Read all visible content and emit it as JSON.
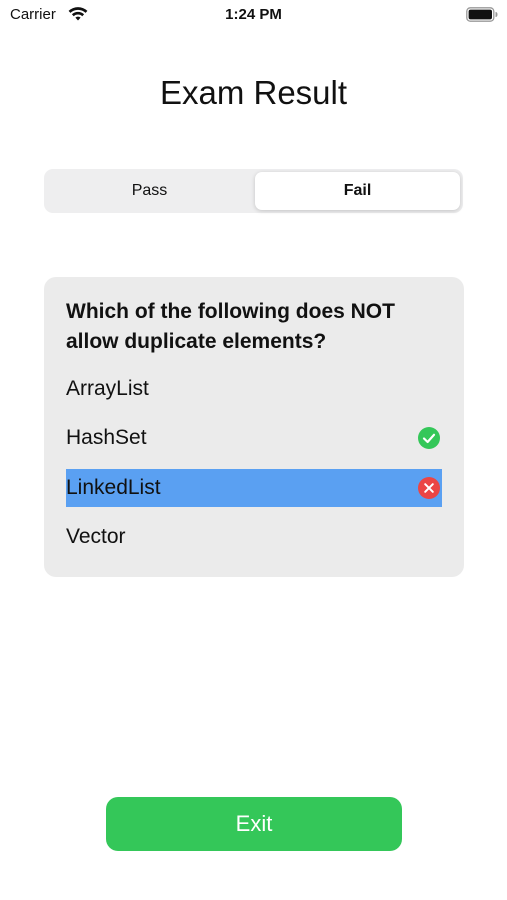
{
  "status_bar": {
    "carrier": "Carrier",
    "time": "1:24 PM",
    "wifi_icon": "wifi-icon",
    "battery_icon": "battery-full-icon"
  },
  "title": "Exam Result",
  "segmented": {
    "options": [
      "Pass",
      "Fail"
    ],
    "selected": "Fail"
  },
  "question": {
    "text": "Which of the following does NOT allow duplicate elements?",
    "options": [
      {
        "label": "ArrayList",
        "status": "none"
      },
      {
        "label": "HashSet",
        "status": "correct",
        "icon": "checkmark-circle-icon"
      },
      {
        "label": "LinkedList",
        "status": "incorrect",
        "selected": true,
        "icon": "x-circle-icon"
      },
      {
        "label": "Vector",
        "status": "none"
      }
    ]
  },
  "exit_button": {
    "label": "Exit"
  },
  "colors": {
    "accent_green": "#34c759",
    "error_red": "#eb4545",
    "selection_blue": "#5aa0f2",
    "card_background": "#ebebeb"
  }
}
